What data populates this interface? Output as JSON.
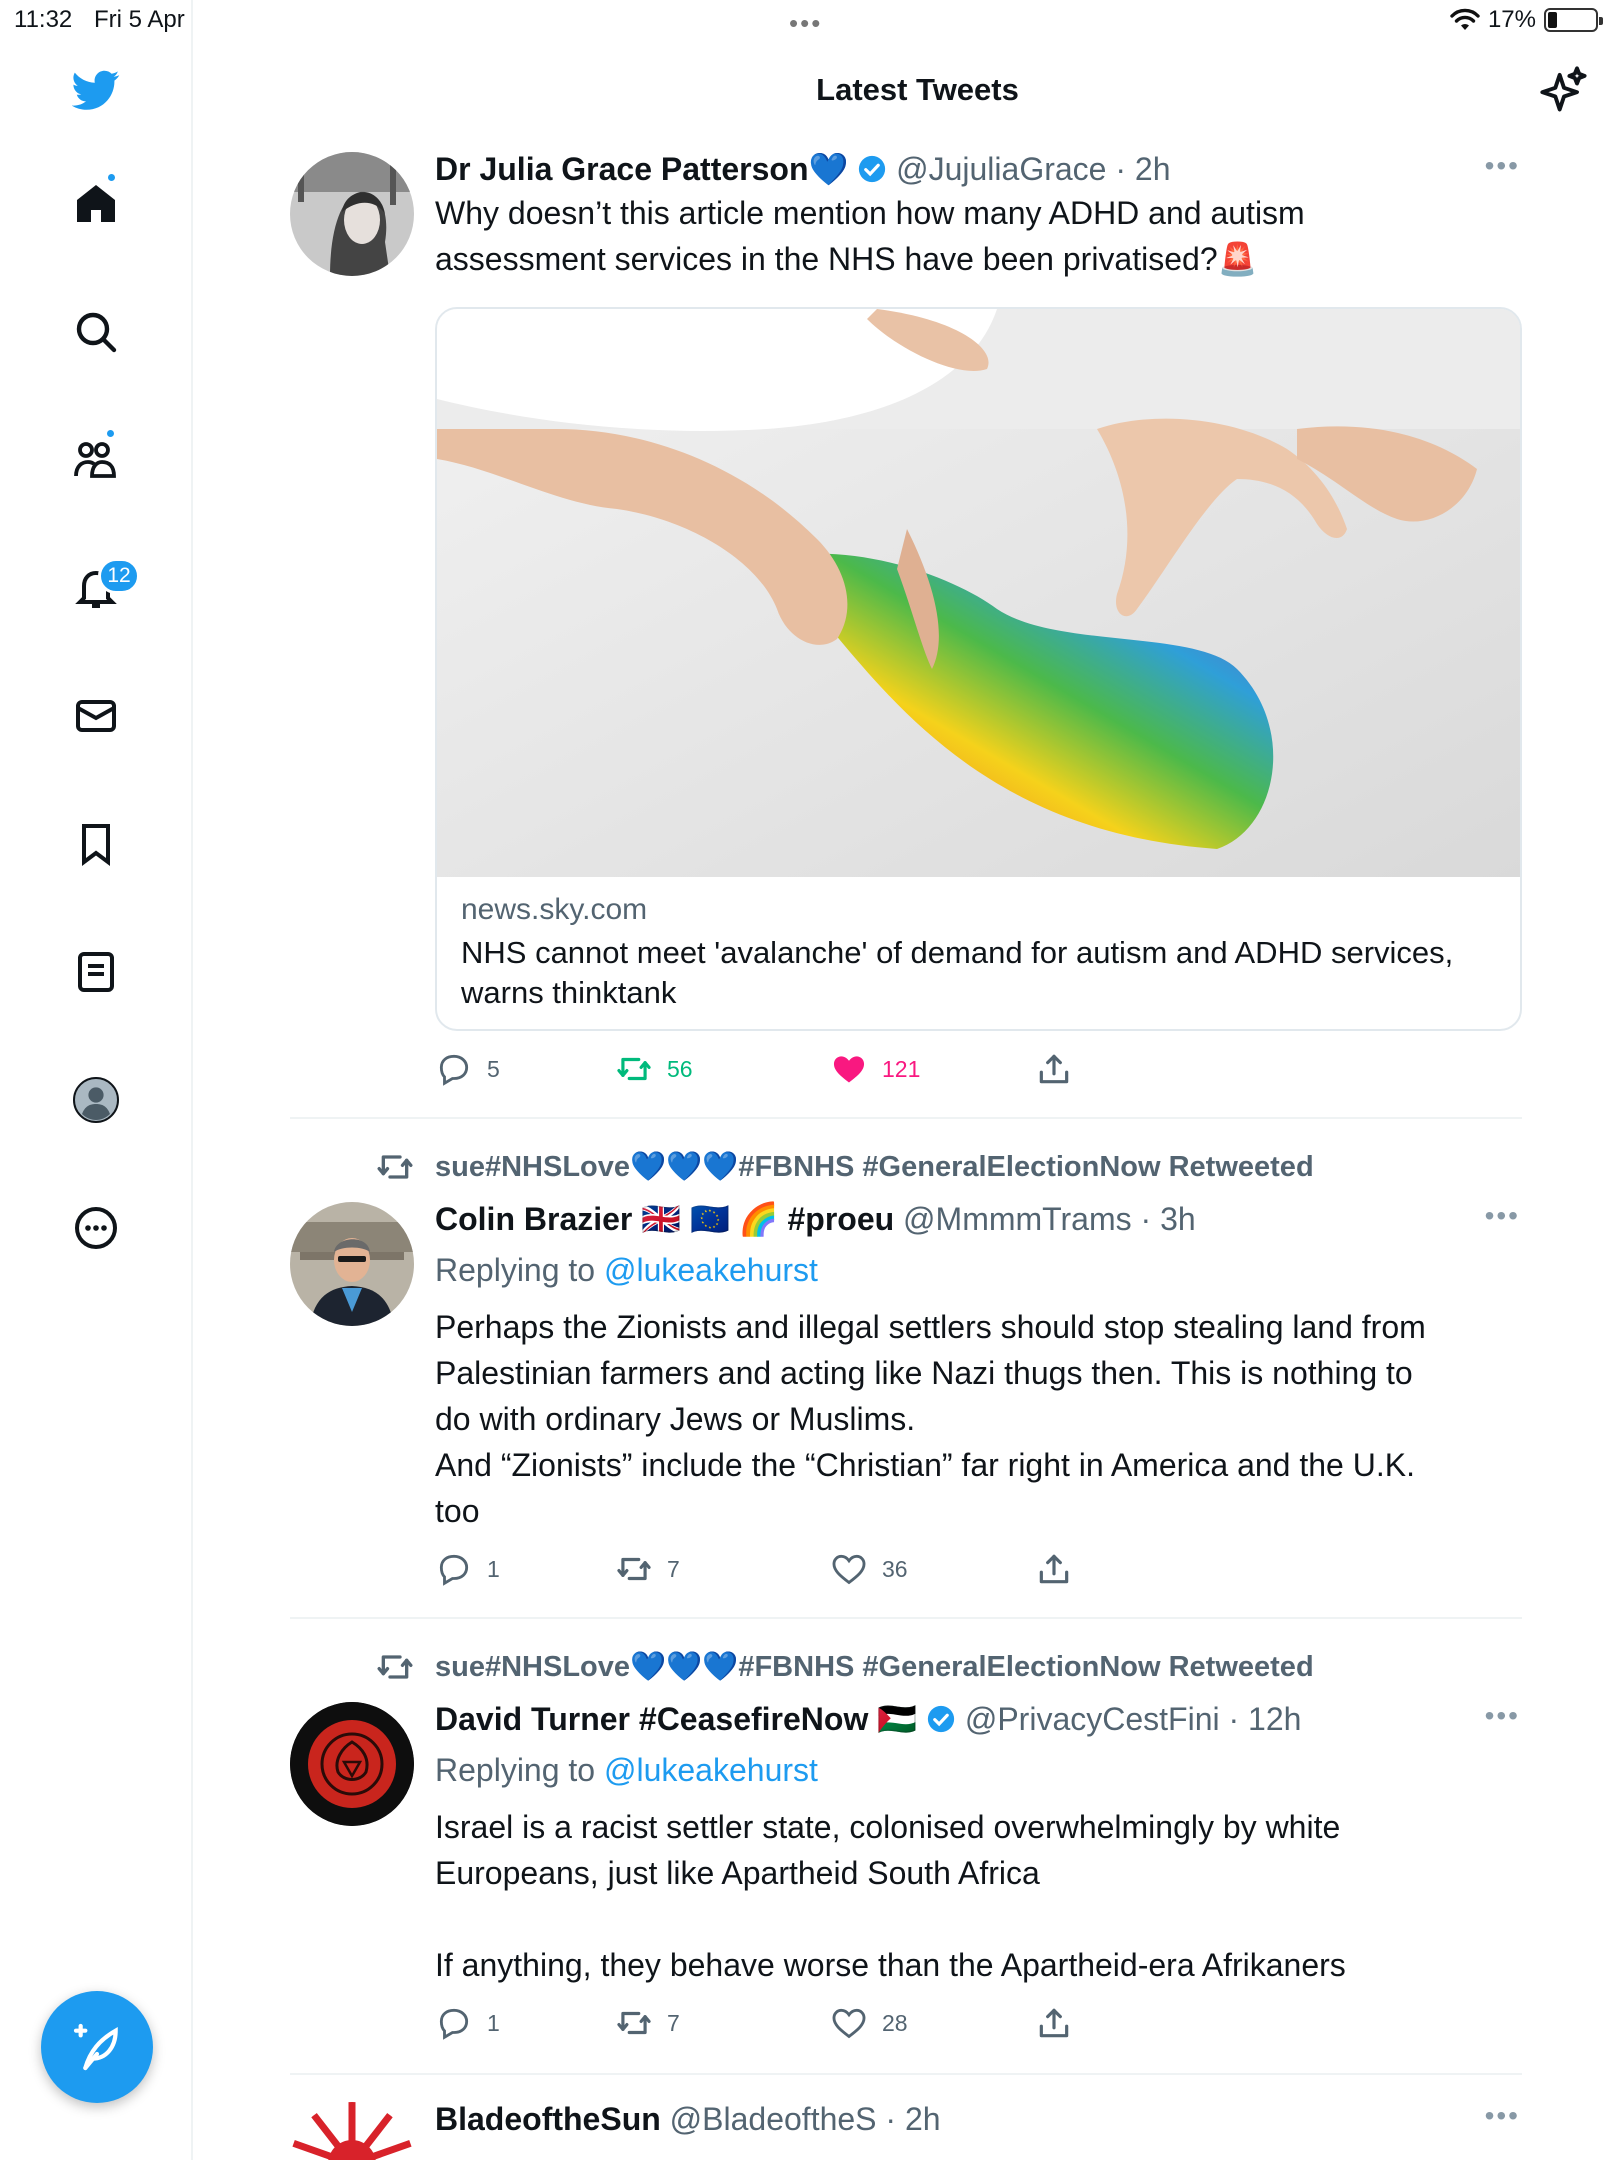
{
  "status_bar": {
    "time": "11:32",
    "date": "Fri 5 Apr",
    "battery": "17%"
  },
  "header": {
    "title": "Latest Tweets"
  },
  "sidebar": {
    "notifications_badge": "12"
  },
  "tweets": [
    {
      "name": "Dr Julia Grace Patterson💙",
      "handle": "@JujuliaGrace",
      "time": "· 2h",
      "text_lines": [
        "Why doesn’t this article mention how many ADHD and autism",
        "assessment services in the NHS have been privatised?🚨"
      ],
      "card": {
        "domain": "news.sky.com",
        "title": "NHS cannot meet 'avalanche' of demand for autism and ADHD services, warns thinktank"
      },
      "stats": {
        "replies": "5",
        "retweets": "56",
        "likes": "121"
      }
    },
    {
      "retweeted_by": "sue#NHSLove💙💙💙#FBNHS #GeneralElectionNow Retweeted",
      "name": "Colin Brazier 🇬🇧 🇪🇺 🌈 #proeu",
      "handle": "@MmmmTrams",
      "time": "· 3h",
      "replying_prefix": "Replying to",
      "replying_to": "@lukeakehurst",
      "text_lines": [
        "Perhaps the Zionists and illegal settlers should stop stealing land from",
        "Palestinian farmers and acting like Nazi thugs then. This is nothing to",
        "do with ordinary Jews or Muslims.",
        "And “Zionists” include the “Christian” far right in America and the U.K.",
        "too"
      ],
      "stats": {
        "replies": "1",
        "retweets": "7",
        "likes": "36"
      }
    },
    {
      "retweeted_by": "sue#NHSLove💙💙💙#FBNHS #GeneralElectionNow Retweeted",
      "name": "David Turner #CeasefireNow 🇵🇸",
      "handle": "@PrivacyCestFini",
      "time": "· 12h",
      "replying_prefix": "Replying to",
      "replying_to": "@lukeakehurst",
      "text_lines": [
        "Israel is a racist settler state, colonised overwhelmingly by white",
        "Europeans, just like Apartheid South Africa",
        "",
        "If anything, they behave worse than the Apartheid-era Afrikaners"
      ],
      "stats": {
        "replies": "1",
        "retweets": "7",
        "likes": "28"
      }
    },
    {
      "name": "BladeoftheSun",
      "handle": "@BladeoftheS",
      "time": "· 2h"
    }
  ],
  "colors": {
    "accent": "#1d9bf0",
    "retweet_active": "#00ba7c",
    "like_active": "#f91880",
    "muted": "#536471"
  }
}
